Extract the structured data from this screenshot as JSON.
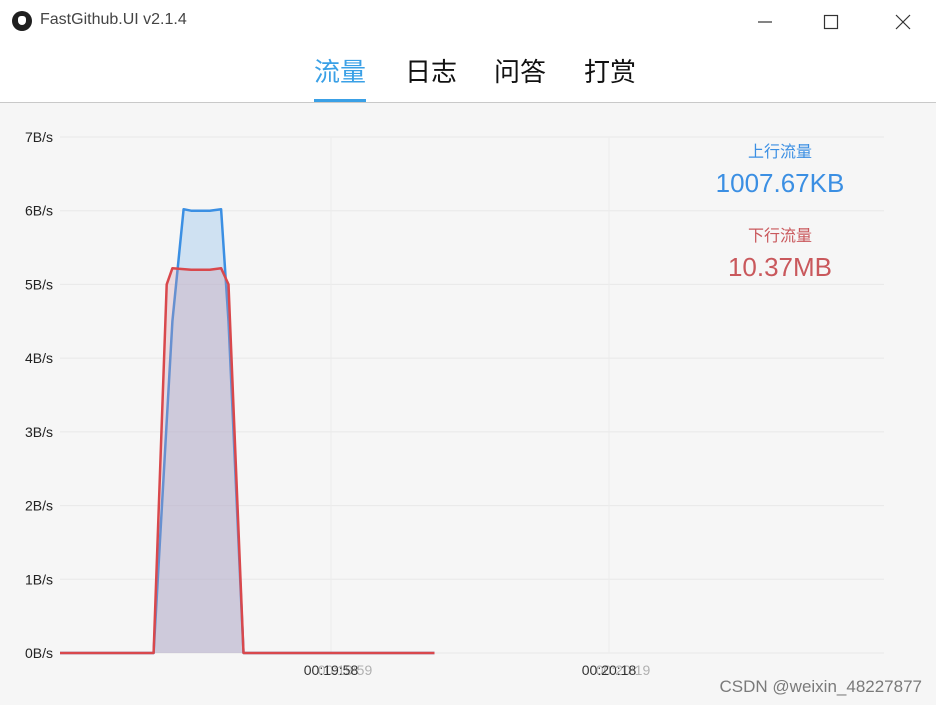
{
  "window": {
    "title": "FastGithub.UI v2.1.4"
  },
  "tabs": [
    {
      "label": "流量",
      "active": true
    },
    {
      "label": "日志",
      "active": false
    },
    {
      "label": "问答",
      "active": false
    },
    {
      "label": "打赏",
      "active": false
    }
  ],
  "stats": {
    "upload_label": "上行流量",
    "upload_value": "1007.67KB",
    "download_label": "下行流量",
    "download_value": "10.37MB"
  },
  "watermark": "CSDN @weixin_48227877",
  "colors": {
    "accent": "#3aa0e6",
    "upload": "#3b8fe3",
    "download": "#d9484c"
  },
  "chart_data": {
    "type": "area",
    "title": "",
    "xlabel": "",
    "ylabel": "",
    "ylim": [
      0,
      7
    ],
    "y_ticks": [
      "0B/s",
      "1B/s",
      "2B/s",
      "3B/s",
      "4B/s",
      "5B/s",
      "6B/s",
      "7B/s"
    ],
    "x_ticks": [
      "00:19:58",
      "00:20:18"
    ],
    "x_ghost_ticks": [
      "00:19:59",
      "00:20:19"
    ],
    "legend": "none",
    "grid": true,
    "series": [
      {
        "points": [
          [
            0,
            0
          ],
          [
            0.5,
            0
          ],
          [
            0.6,
            4.5
          ],
          [
            0.66,
            6.02
          ],
          [
            0.7,
            6.0
          ],
          [
            0.8,
            6.0
          ],
          [
            0.86,
            6.02
          ],
          [
            0.9,
            4.5
          ],
          [
            0.98,
            0
          ],
          [
            2,
            0
          ]
        ]
      },
      {
        "points": [
          [
            0,
            0
          ],
          [
            0.5,
            0
          ],
          [
            0.57,
            5.0
          ],
          [
            0.6,
            5.22
          ],
          [
            0.7,
            5.2
          ],
          [
            0.8,
            5.2
          ],
          [
            0.86,
            5.22
          ],
          [
            0.9,
            5.0
          ],
          [
            0.98,
            0
          ],
          [
            2,
            0
          ]
        ]
      }
    ]
  }
}
